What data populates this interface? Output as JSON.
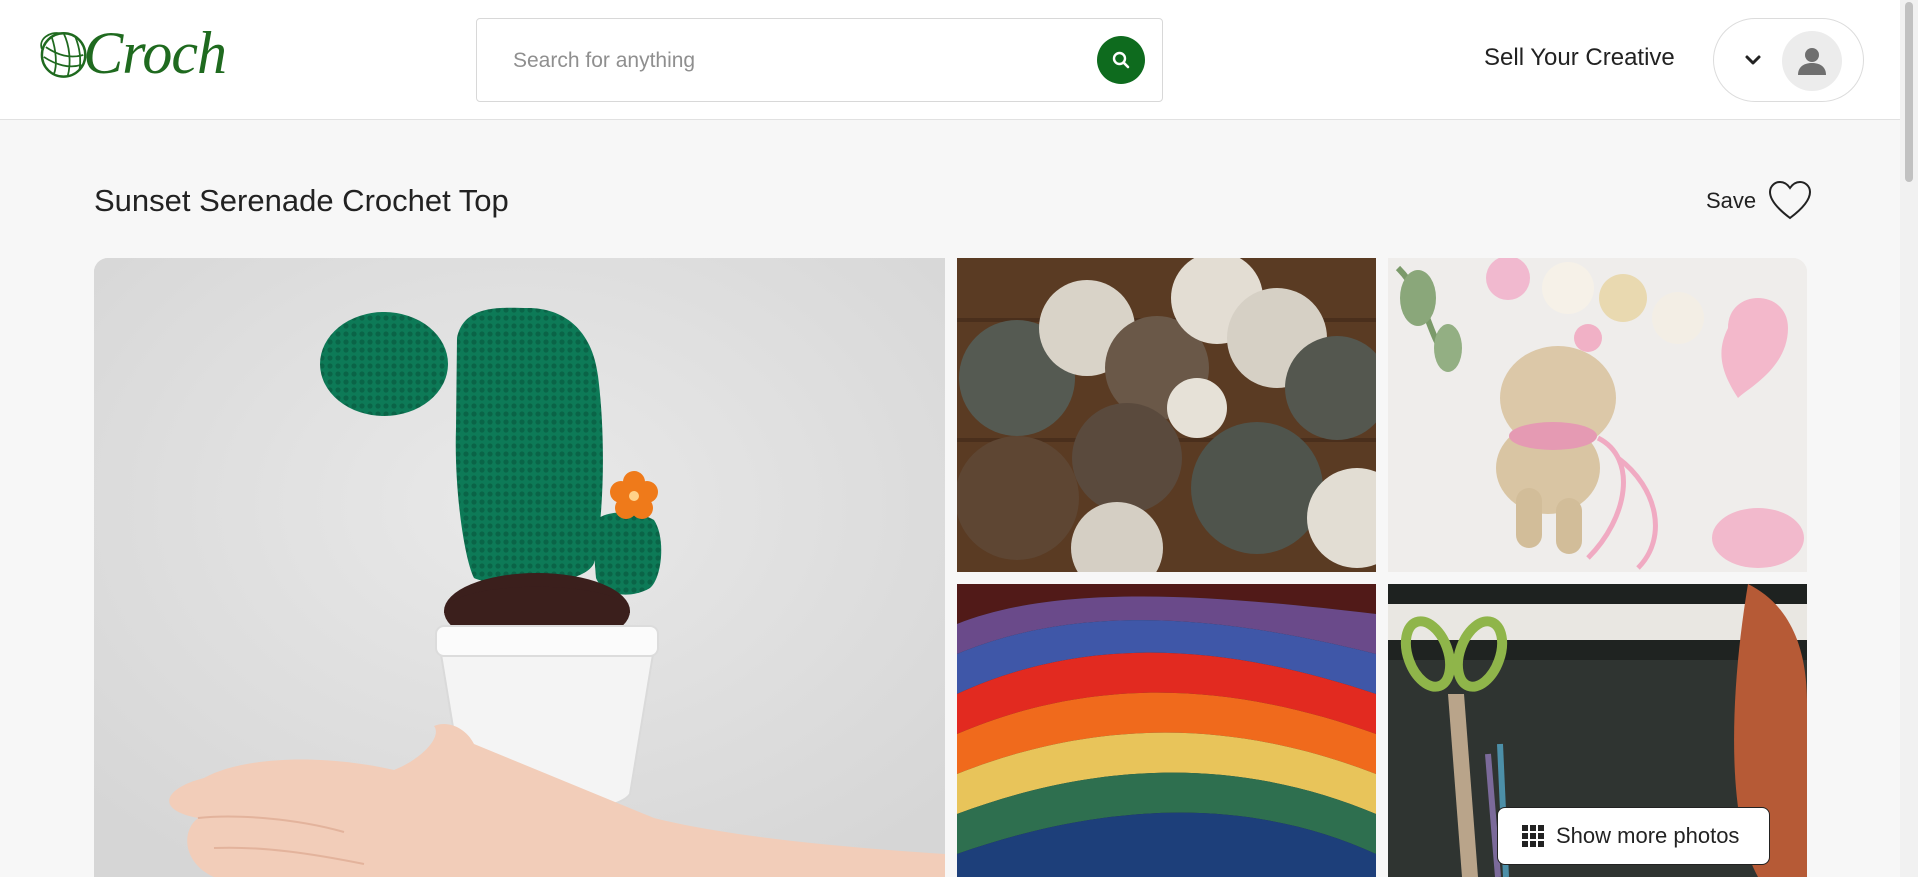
{
  "header": {
    "logo_text": "Croch",
    "search_placeholder": "Search for anything",
    "sell_label": "Sell Your Creative"
  },
  "listing": {
    "title": "Sunset Serenade Crochet Top",
    "save_label": "Save",
    "show_more_label": "Show more photos"
  },
  "photos": [
    {
      "subject": "crochet cactus in white pot held in hand"
    },
    {
      "subject": "yarn balls on wooden table"
    },
    {
      "subject": "crochet amigurumi deer toy"
    },
    {
      "subject": "rainbow striped crochet blanket"
    },
    {
      "subject": "scissors and hooks on dark crochet fabric"
    }
  ],
  "colors": {
    "brand_green": "#0e6b1e",
    "background": "#f7f7f7",
    "header_bg": "#ffffff"
  },
  "icons": [
    "yarn-ball-logo-icon",
    "search-icon",
    "chevron-down-icon",
    "user-icon",
    "heart-icon",
    "grid-icon"
  ]
}
